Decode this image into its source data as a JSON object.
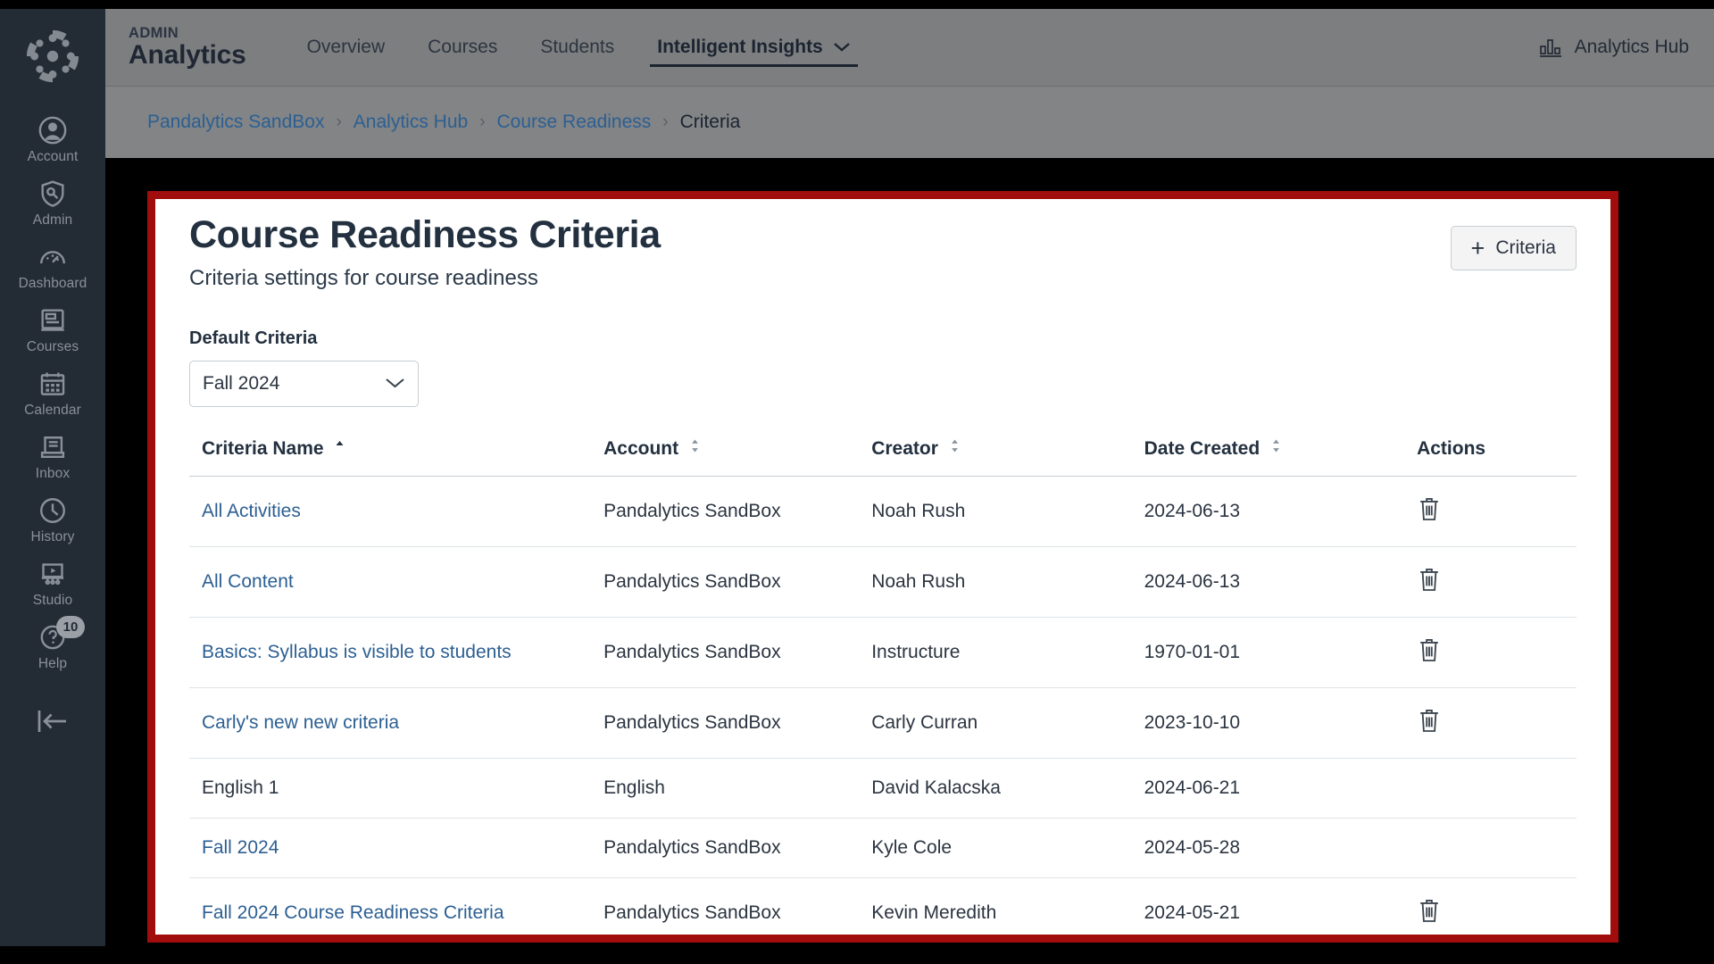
{
  "global_nav": {
    "logo": "canvas-logo",
    "items": [
      {
        "label": "Account",
        "icon": "user-circle-icon"
      },
      {
        "label": "Admin",
        "icon": "shield-wrench-icon"
      },
      {
        "label": "Dashboard",
        "icon": "gauge-icon"
      },
      {
        "label": "Courses",
        "icon": "book-icon"
      },
      {
        "label": "Calendar",
        "icon": "calendar-icon"
      },
      {
        "label": "Inbox",
        "icon": "inbox-icon"
      },
      {
        "label": "History",
        "icon": "clock-icon"
      },
      {
        "label": "Studio",
        "icon": "studio-icon"
      },
      {
        "label": "Help",
        "icon": "help-question-icon",
        "badge": "10"
      }
    ],
    "collapse": "collapse-nav-icon"
  },
  "header": {
    "kicker": "ADMIN",
    "title": "Analytics",
    "tabs": [
      {
        "label": "Overview",
        "active": false
      },
      {
        "label": "Courses",
        "active": false
      },
      {
        "label": "Students",
        "active": false
      },
      {
        "label": "Intelligent Insights",
        "active": true,
        "has_chevron": true
      }
    ],
    "hub_label": "Analytics Hub",
    "hub_icon": "bar-chart-icon"
  },
  "breadcrumb": {
    "items": [
      {
        "label": "Pandalytics SandBox",
        "current": false
      },
      {
        "label": "Analytics Hub",
        "current": false
      },
      {
        "label": "Course Readiness",
        "current": false
      },
      {
        "label": "Criteria",
        "current": true
      }
    ],
    "separator": "›"
  },
  "page": {
    "title": "Course Readiness Criteria",
    "subtitle": "Criteria settings for course readiness",
    "add_button": {
      "plus": "+",
      "label": "Criteria"
    },
    "default_criteria_label": "Default Criteria",
    "default_criteria_value": "Fall 2024"
  },
  "table": {
    "columns": [
      {
        "label": "Criteria Name",
        "sort": "asc"
      },
      {
        "label": "Account",
        "sort": "none"
      },
      {
        "label": "Creator",
        "sort": "none"
      },
      {
        "label": "Date Created",
        "sort": "none"
      },
      {
        "label": "Actions",
        "sort": null
      }
    ],
    "rows": [
      {
        "name": "All Activities",
        "link": true,
        "account": "Pandalytics SandBox",
        "creator": "Noah Rush",
        "date": "2024-06-13",
        "deletable": true
      },
      {
        "name": "All Content",
        "link": true,
        "account": "Pandalytics SandBox",
        "creator": "Noah Rush",
        "date": "2024-06-13",
        "deletable": true
      },
      {
        "name": "Basics: Syllabus is visible to students",
        "link": true,
        "account": "Pandalytics SandBox",
        "creator": "Instructure",
        "date": "1970-01-01",
        "deletable": true
      },
      {
        "name": "Carly's new new criteria",
        "link": true,
        "account": "Pandalytics SandBox",
        "creator": "Carly Curran",
        "date": "2023-10-10",
        "deletable": true
      },
      {
        "name": "English 1",
        "link": false,
        "account": "English",
        "creator": "David Kalacska",
        "date": "2024-06-21",
        "deletable": false
      },
      {
        "name": "Fall 2024",
        "link": true,
        "account": "Pandalytics SandBox",
        "creator": "Kyle Cole",
        "date": "2024-05-28",
        "deletable": false
      },
      {
        "name": "Fall 2024 Course Readiness Criteria",
        "link": true,
        "account": "Pandalytics SandBox",
        "creator": "Kevin Meredith",
        "date": "2024-05-21",
        "deletable": true
      }
    ],
    "delete_icon": "trash-icon"
  },
  "colors": {
    "highlight_border": "#a10d0d",
    "link": "#2c5f92",
    "nav_bg": "#232b35",
    "header_bg": "#7c7e80"
  }
}
